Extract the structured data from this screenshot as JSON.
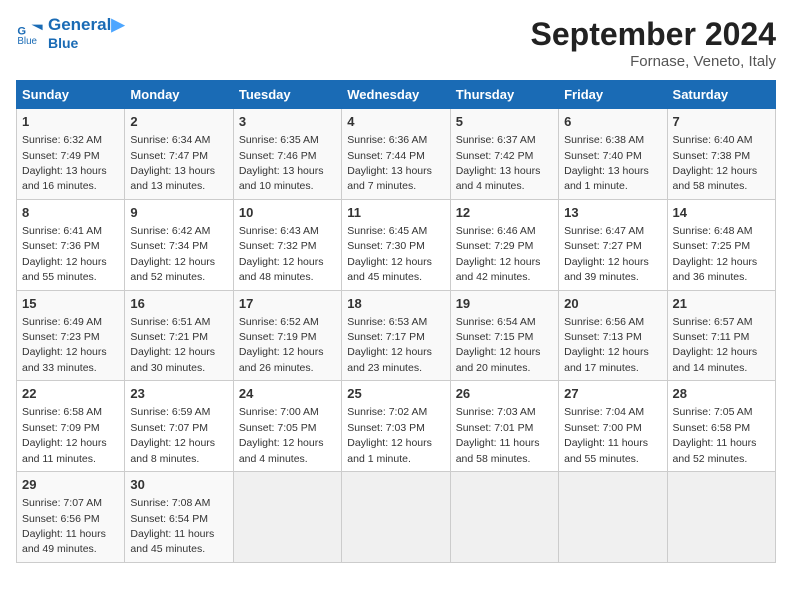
{
  "header": {
    "logo_line1": "General",
    "logo_line2": "Blue",
    "month_title": "September 2024",
    "location": "Fornase, Veneto, Italy"
  },
  "weekdays": [
    "Sunday",
    "Monday",
    "Tuesday",
    "Wednesday",
    "Thursday",
    "Friday",
    "Saturday"
  ],
  "weeks": [
    [
      {
        "day": "1",
        "sunrise": "6:32 AM",
        "sunset": "7:49 PM",
        "daylight": "13 hours and 16 minutes."
      },
      {
        "day": "2",
        "sunrise": "6:34 AM",
        "sunset": "7:47 PM",
        "daylight": "13 hours and 13 minutes."
      },
      {
        "day": "3",
        "sunrise": "6:35 AM",
        "sunset": "7:46 PM",
        "daylight": "13 hours and 10 minutes."
      },
      {
        "day": "4",
        "sunrise": "6:36 AM",
        "sunset": "7:44 PM",
        "daylight": "13 hours and 7 minutes."
      },
      {
        "day": "5",
        "sunrise": "6:37 AM",
        "sunset": "7:42 PM",
        "daylight": "13 hours and 4 minutes."
      },
      {
        "day": "6",
        "sunrise": "6:38 AM",
        "sunset": "7:40 PM",
        "daylight": "13 hours and 1 minute."
      },
      {
        "day": "7",
        "sunrise": "6:40 AM",
        "sunset": "7:38 PM",
        "daylight": "12 hours and 58 minutes."
      }
    ],
    [
      {
        "day": "8",
        "sunrise": "6:41 AM",
        "sunset": "7:36 PM",
        "daylight": "12 hours and 55 minutes."
      },
      {
        "day": "9",
        "sunrise": "6:42 AM",
        "sunset": "7:34 PM",
        "daylight": "12 hours and 52 minutes."
      },
      {
        "day": "10",
        "sunrise": "6:43 AM",
        "sunset": "7:32 PM",
        "daylight": "12 hours and 48 minutes."
      },
      {
        "day": "11",
        "sunrise": "6:45 AM",
        "sunset": "7:30 PM",
        "daylight": "12 hours and 45 minutes."
      },
      {
        "day": "12",
        "sunrise": "6:46 AM",
        "sunset": "7:29 PM",
        "daylight": "12 hours and 42 minutes."
      },
      {
        "day": "13",
        "sunrise": "6:47 AM",
        "sunset": "7:27 PM",
        "daylight": "12 hours and 39 minutes."
      },
      {
        "day": "14",
        "sunrise": "6:48 AM",
        "sunset": "7:25 PM",
        "daylight": "12 hours and 36 minutes."
      }
    ],
    [
      {
        "day": "15",
        "sunrise": "6:49 AM",
        "sunset": "7:23 PM",
        "daylight": "12 hours and 33 minutes."
      },
      {
        "day": "16",
        "sunrise": "6:51 AM",
        "sunset": "7:21 PM",
        "daylight": "12 hours and 30 minutes."
      },
      {
        "day": "17",
        "sunrise": "6:52 AM",
        "sunset": "7:19 PM",
        "daylight": "12 hours and 26 minutes."
      },
      {
        "day": "18",
        "sunrise": "6:53 AM",
        "sunset": "7:17 PM",
        "daylight": "12 hours and 23 minutes."
      },
      {
        "day": "19",
        "sunrise": "6:54 AM",
        "sunset": "7:15 PM",
        "daylight": "12 hours and 20 minutes."
      },
      {
        "day": "20",
        "sunrise": "6:56 AM",
        "sunset": "7:13 PM",
        "daylight": "12 hours and 17 minutes."
      },
      {
        "day": "21",
        "sunrise": "6:57 AM",
        "sunset": "7:11 PM",
        "daylight": "12 hours and 14 minutes."
      }
    ],
    [
      {
        "day": "22",
        "sunrise": "6:58 AM",
        "sunset": "7:09 PM",
        "daylight": "12 hours and 11 minutes."
      },
      {
        "day": "23",
        "sunrise": "6:59 AM",
        "sunset": "7:07 PM",
        "daylight": "12 hours and 8 minutes."
      },
      {
        "day": "24",
        "sunrise": "7:00 AM",
        "sunset": "7:05 PM",
        "daylight": "12 hours and 4 minutes."
      },
      {
        "day": "25",
        "sunrise": "7:02 AM",
        "sunset": "7:03 PM",
        "daylight": "12 hours and 1 minute."
      },
      {
        "day": "26",
        "sunrise": "7:03 AM",
        "sunset": "7:01 PM",
        "daylight": "11 hours and 58 minutes."
      },
      {
        "day": "27",
        "sunrise": "7:04 AM",
        "sunset": "7:00 PM",
        "daylight": "11 hours and 55 minutes."
      },
      {
        "day": "28",
        "sunrise": "7:05 AM",
        "sunset": "6:58 PM",
        "daylight": "11 hours and 52 minutes."
      }
    ],
    [
      {
        "day": "29",
        "sunrise": "7:07 AM",
        "sunset": "6:56 PM",
        "daylight": "11 hours and 49 minutes."
      },
      {
        "day": "30",
        "sunrise": "7:08 AM",
        "sunset": "6:54 PM",
        "daylight": "11 hours and 45 minutes."
      },
      null,
      null,
      null,
      null,
      null
    ]
  ]
}
